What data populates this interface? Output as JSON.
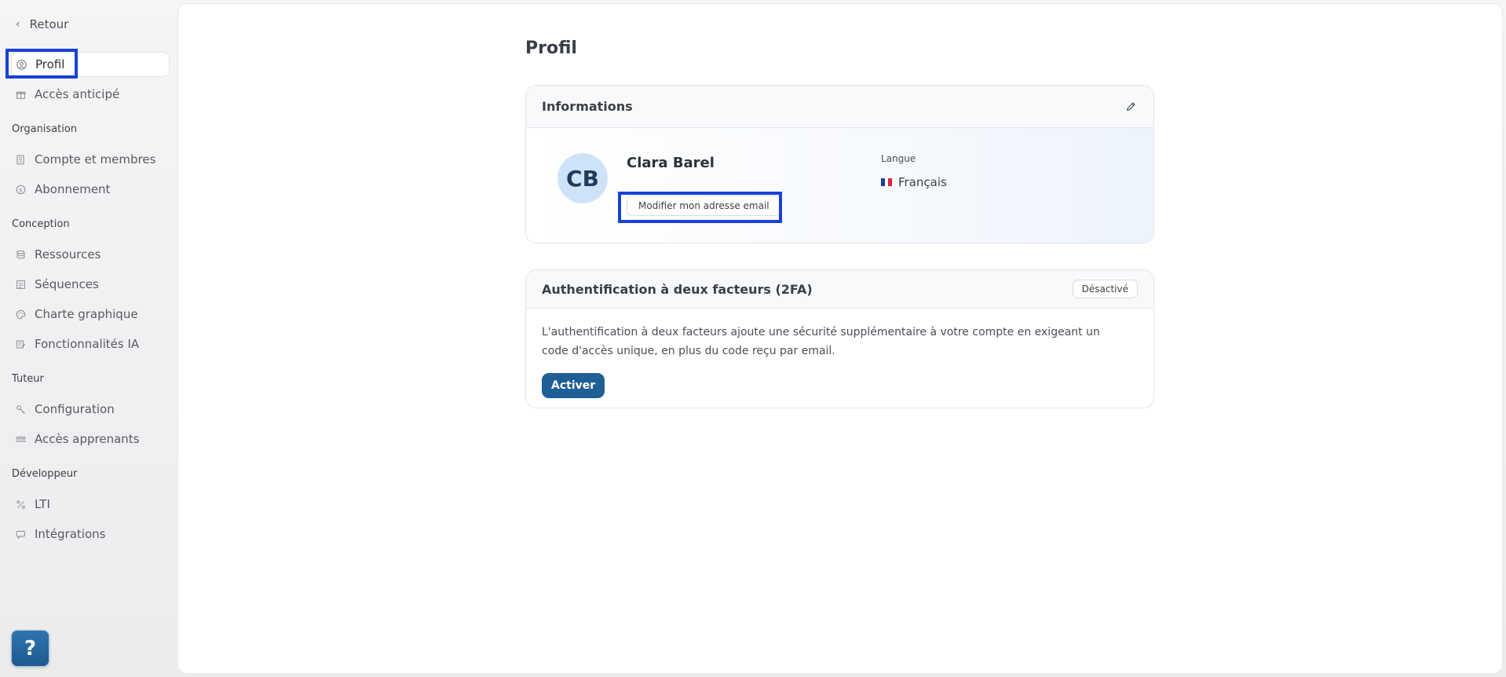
{
  "sidebar": {
    "back_label": "Retour",
    "items_top": [
      {
        "label": "Profil",
        "icon": "user-circle-icon"
      },
      {
        "label": "Accès anticipé",
        "icon": "gift-icon"
      }
    ],
    "sections": [
      {
        "title": "Organisation",
        "items": [
          {
            "label": "Compte et membres",
            "icon": "document-icon"
          },
          {
            "label": "Abonnement",
            "icon": "coin-icon"
          }
        ]
      },
      {
        "title": "Conception",
        "items": [
          {
            "label": "Ressources",
            "icon": "database-icon"
          },
          {
            "label": "Séquences",
            "icon": "list-icon"
          },
          {
            "label": "Charte graphique",
            "icon": "palette-icon"
          },
          {
            "label": "Fonctionnalités IA",
            "icon": "ai-edit-icon"
          }
        ]
      },
      {
        "title": "Tuteur",
        "items": [
          {
            "label": "Configuration",
            "icon": "wrench-icon"
          },
          {
            "label": "Accès apprenants",
            "icon": "users-icon"
          }
        ]
      },
      {
        "title": "Développeur",
        "items": [
          {
            "label": "LTI",
            "icon": "percent-icon"
          },
          {
            "label": "Intégrations",
            "icon": "plug-icon"
          }
        ]
      }
    ],
    "help_label": "?"
  },
  "main": {
    "page_title": "Profil",
    "info_card": {
      "title": "Informations",
      "avatar_initials": "CB",
      "user_name": "Clara Barel",
      "email_button": "Modifier mon adresse email",
      "language_label": "Langue",
      "language_value": "Français"
    },
    "twofa_card": {
      "title": "Authentification à deux facteurs (2FA)",
      "status_badge": "Désactivé",
      "description": "L'authentification à deux facteurs ajoute une sécurité supplémentaire à votre compte en exigeant un code d'accès unique, en plus du code reçu par email.",
      "activate_button": "Activer"
    }
  },
  "colors": {
    "highlight_box": "#1741d9",
    "primary_button": "#1e5f96",
    "avatar_bg": "#cfe3f8"
  }
}
